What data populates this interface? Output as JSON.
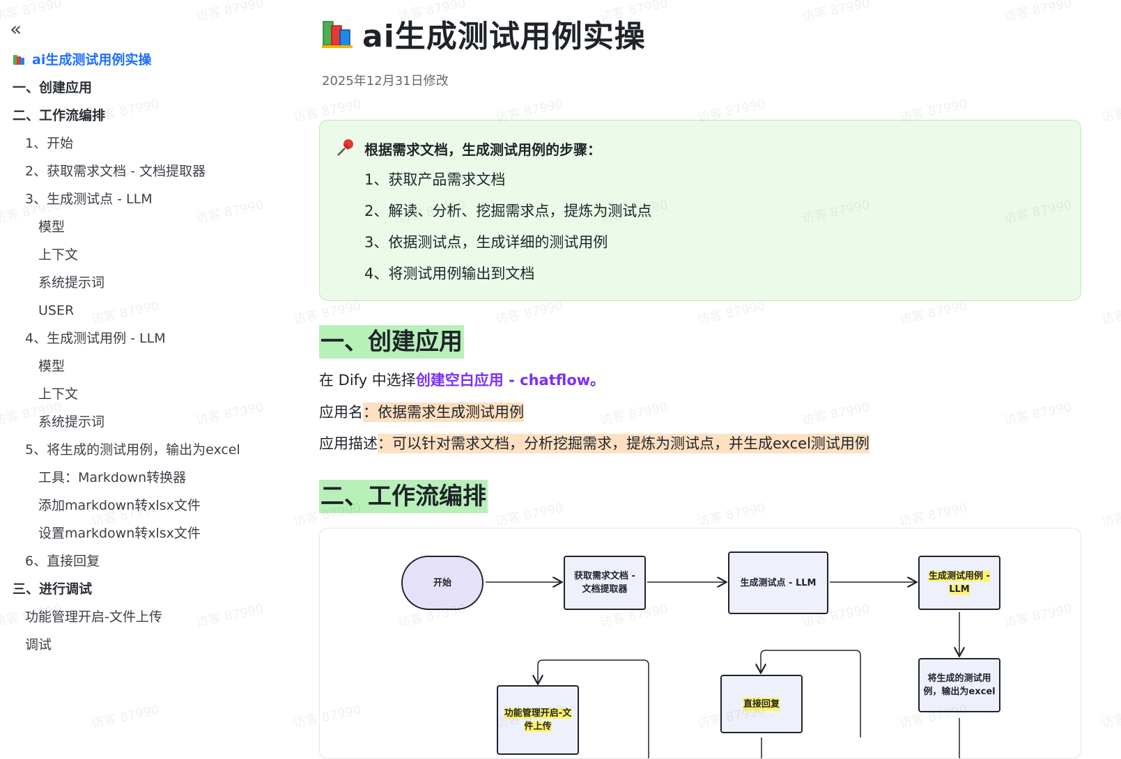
{
  "sidebar": {
    "collapse_label": "«",
    "items": [
      {
        "label": "ai生成测试用例实操",
        "level": 0,
        "active": true
      },
      {
        "label": "一、创建应用",
        "level": 0
      },
      {
        "label": "二、工作流编排",
        "level": 0
      },
      {
        "label": "1、开始",
        "level": 1
      },
      {
        "label": "2、获取需求文档 - 文档提取器",
        "level": 1
      },
      {
        "label": "3、生成测试点 - LLM",
        "level": 1
      },
      {
        "label": "模型",
        "level": 2
      },
      {
        "label": "上下文",
        "level": 2
      },
      {
        "label": "系统提示词",
        "level": 2
      },
      {
        "label": "USER",
        "level": 2
      },
      {
        "label": "4、生成测试用例 - LLM",
        "level": 1
      },
      {
        "label": "模型",
        "level": 2
      },
      {
        "label": "上下文",
        "level": 2
      },
      {
        "label": "系统提示词",
        "level": 2
      },
      {
        "label": "5、将生成的测试用例，输出为excel",
        "level": 1
      },
      {
        "label": "工具：Markdown转换器",
        "level": 2
      },
      {
        "label": "添加markdown转xlsx文件",
        "level": 2
      },
      {
        "label": "设置markdown转xlsx文件",
        "level": 2
      },
      {
        "label": "6、直接回复",
        "level": 1
      },
      {
        "label": "三、进行调试",
        "level": 0
      },
      {
        "label": "功能管理开启-文件上传",
        "level": 1
      },
      {
        "label": "调试",
        "level": 1
      }
    ]
  },
  "page": {
    "title": "ai生成测试用例实操",
    "modified": "2025年12月31日修改",
    "title_icon": "books-icon"
  },
  "callout": {
    "icon": "pushpin-icon",
    "heading": "根据需求文档，生成测试用例的步骤：",
    "steps": [
      "1、获取产品需求文档",
      "2、解读、分析、挖掘需求点，提炼为测试点",
      "3、依据测试点，生成详细的测试用例",
      "4、将测试用例输出到文档"
    ]
  },
  "section1": {
    "heading": "一、创建应用",
    "line1_prefix": "在 Dify 中选择",
    "line1_link": "创建空白应用 - chatflow。",
    "line2_label": "应用名",
    "line2_value": "：依据需求生成测试用例",
    "line3_label": "应用描述",
    "line3_value": "：可以针对需求文档，分析挖掘需求，提炼为测试点，并生成excel测试用例"
  },
  "section2": {
    "heading": "二、工作流编排"
  },
  "flow": {
    "start": "开始",
    "extract_line1": "获取需求文档 -",
    "extract_line2": "文档提取器",
    "testpoint": "生成测试点 - LLM",
    "testcase_line1": "生成测试用例 -",
    "testcase_line2": "LLM",
    "excel_line1": "将生成的测试用",
    "excel_line2": "例，输出为excel",
    "reply": "直接回复",
    "upload_line1": "功能管理开启-文",
    "upload_line2": "件上传"
  },
  "watermark": {
    "text": "访客 87990"
  },
  "colors": {
    "active_link": "#1f6fff",
    "callout_bg": "#ecfbe9",
    "heading_highlight": "#b7f0b9",
    "orange_highlight": "#ffe0c1",
    "purple_link": "#7b2ff7",
    "node_yellow": "#fff46a"
  }
}
